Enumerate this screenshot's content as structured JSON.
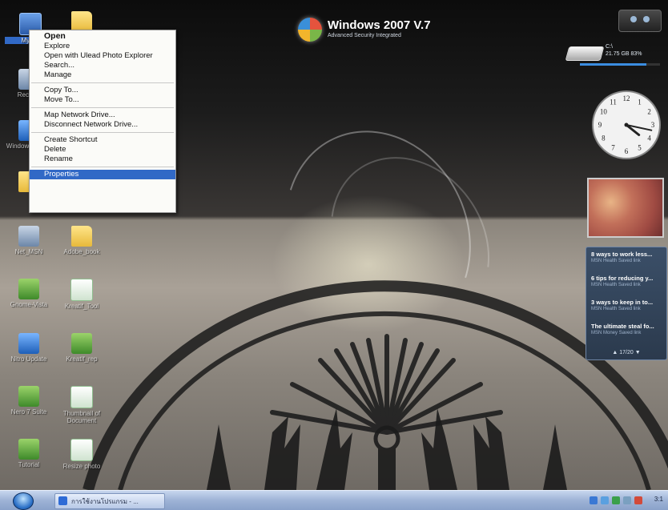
{
  "banner": {
    "title": "Windows 2007 V.7",
    "subtitle": "Advanced Security Integrated"
  },
  "context_menu": {
    "items": [
      {
        "label": "Open",
        "bold": true
      },
      {
        "label": "Explore"
      },
      {
        "label": "Open with Ulead Photo Explorer"
      },
      {
        "label": "Search..."
      },
      {
        "label": "Manage"
      },
      {
        "separator": true
      },
      {
        "label": "Copy To..."
      },
      {
        "label": "Move To..."
      },
      {
        "separator": true
      },
      {
        "label": "Map Network Drive..."
      },
      {
        "label": "Disconnect Network Drive..."
      },
      {
        "separator": true
      },
      {
        "label": "Create Shortcut"
      },
      {
        "label": "Delete"
      },
      {
        "label": "Rename"
      },
      {
        "separator": true
      },
      {
        "label": "Properties",
        "selected": true
      }
    ]
  },
  "desktop_icons": {
    "col1": [
      {
        "label": "My Co",
        "icon": "computer-icon"
      },
      {
        "label": "Recycle",
        "icon": "network-icon"
      },
      {
        "label": "Windows Media",
        "icon": "media-icon"
      },
      {
        "label": "",
        "icon": "folder-icon"
      },
      {
        "label": "Net_MSN",
        "icon": "network-icon"
      },
      {
        "label": "Gnome-Vista",
        "icon": "app-icon"
      },
      {
        "label": "Nitro Update",
        "icon": "app-icon"
      },
      {
        "label": "Nero 7 Suite",
        "icon": "app-icon"
      },
      {
        "label": "Tutorial",
        "icon": "app-icon"
      }
    ],
    "col2": [
      {
        "label": "",
        "icon": "folder-icon"
      },
      {
        "label": "Adobe_book",
        "icon": "folder-icon"
      },
      {
        "label": "Kreatif_Tool",
        "icon": "doc-icon"
      },
      {
        "label": "Kreatif_rep",
        "icon": "app-icon"
      },
      {
        "label": "Thumbnail of Document",
        "icon": "doc-icon"
      },
      {
        "label": "Resize photo",
        "icon": "doc-icon"
      }
    ]
  },
  "sidebar": {
    "drive": {
      "line1": "C:\\",
      "line2": "21.75 GB    83%",
      "used_fraction": 0.83
    },
    "clock": {
      "hour": 4,
      "minute": 17
    },
    "feed": {
      "items": [
        {
          "title": "8 ways to work less...",
          "source": "MSN Health",
          "time": "Saved link"
        },
        {
          "title": "6 tips for reducing y...",
          "source": "MSN Health",
          "time": "Saved link"
        },
        {
          "title": "3 ways to keep in to...",
          "source": "MSN Health",
          "time": "Saved link"
        },
        {
          "title": "The ultimate steal fo...",
          "source": "MSN Money",
          "time": "Saved link"
        }
      ],
      "pager": "▲  17/20  ▼"
    }
  },
  "taskbar": {
    "task_label": "การใช้งานโปรแกรม - ...",
    "clock": "3:1"
  },
  "colors": {
    "menu_highlight": "#3169c6",
    "taskbar": "#9eb3d6",
    "feed_bg": "#2b3a4d"
  }
}
